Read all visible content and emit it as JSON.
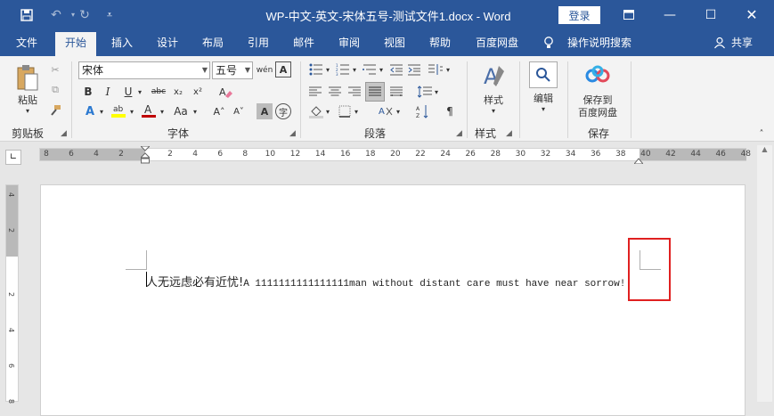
{
  "titlebar": {
    "title": "WP-中文-英文-宋体五号-测试文件1.docx  -  Word",
    "login": "登录",
    "icons": [
      "save-icon",
      "undo-icon",
      "redo-icon",
      "customize-icon",
      "ribbon-display-icon",
      "minimize-icon",
      "maximize-icon",
      "close-icon"
    ]
  },
  "tabs": [
    "文件",
    "开始",
    "插入",
    "设计",
    "布局",
    "引用",
    "邮件",
    "审阅",
    "视图",
    "帮助",
    "百度网盘"
  ],
  "active_tab": "开始",
  "tell_me": "操作说明搜索",
  "share": "共享",
  "ribbon": {
    "clipboard": {
      "label": "剪贴板",
      "paste": "粘贴"
    },
    "font": {
      "label": "字体",
      "font_name": "宋体",
      "font_size": "五号"
    },
    "paragraph": {
      "label": "段落"
    },
    "styles": {
      "label": "样式",
      "button": "样式"
    },
    "editing": {
      "button": "编辑"
    },
    "save": {
      "label": "保存",
      "line1": "保存到",
      "line2": "百度网盘"
    }
  },
  "hruler_ticks": [
    "8",
    "6",
    "4",
    "2",
    "2",
    "4",
    "6",
    "8",
    "10",
    "12",
    "14",
    "16",
    "18",
    "20",
    "22",
    "24",
    "26",
    "28",
    "30",
    "32",
    "34",
    "36",
    "38",
    "40",
    "42",
    "44",
    "46",
    "48"
  ],
  "vruler_ticks": [
    "4",
    "2",
    "2",
    "4",
    "6",
    "8"
  ],
  "document": {
    "zh_text": "人无远虑必有近忧!",
    "en_text": "A 1111111111111111man without distant care must have near sorrow!"
  },
  "colors": {
    "brand": "#2b579a",
    "highlight_box": "#e02020",
    "font_color": "#c00000",
    "highlight_color": "#ffff00"
  }
}
